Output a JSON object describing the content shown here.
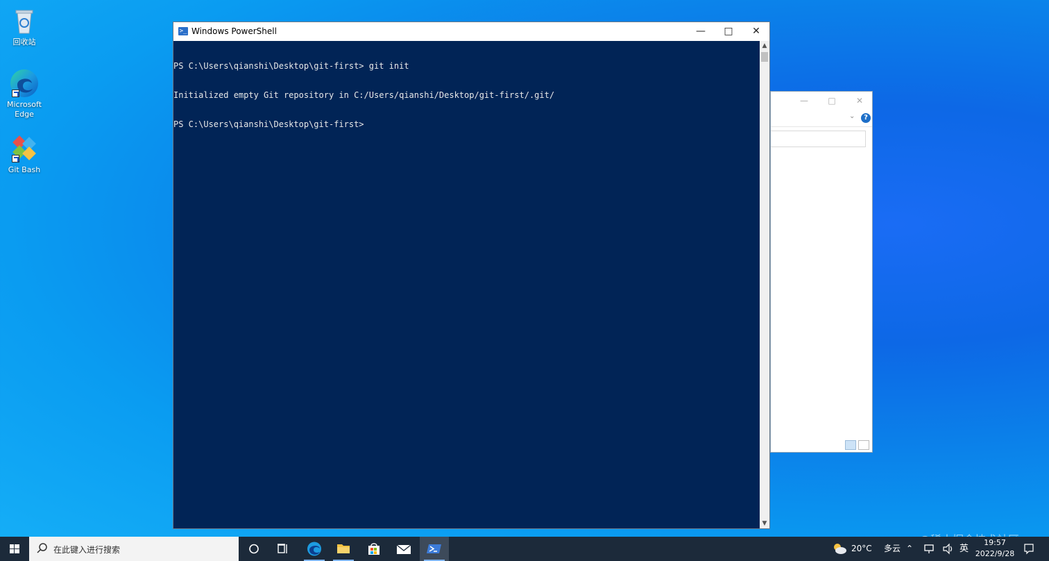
{
  "desktop": {
    "icons": [
      {
        "label": "回收站"
      },
      {
        "label": "Microsoft Edge"
      },
      {
        "label": "Git Bash"
      }
    ]
  },
  "powershell": {
    "title": "Windows PowerShell",
    "lines": [
      "PS C:\\Users\\qianshi\\Desktop\\git-first> git init",
      "Initialized empty Git repository in C:/Users/qianshi/Desktop/git-first/.git/",
      "PS C:\\Users\\qianshi\\Desktop\\git-first>"
    ]
  },
  "bg_window": {
    "help_label": "?"
  },
  "taskbar": {
    "search_placeholder": "在此键入进行搜索",
    "weather_temp": "20°C",
    "weather_desc": "多云",
    "ime": "英",
    "time": "19:57",
    "date": "2022/9/28"
  },
  "watermark": "@稀土掘金技术社区",
  "colors": {
    "console_bg": "#012456",
    "taskbar_bg": "#1c2a3a"
  }
}
